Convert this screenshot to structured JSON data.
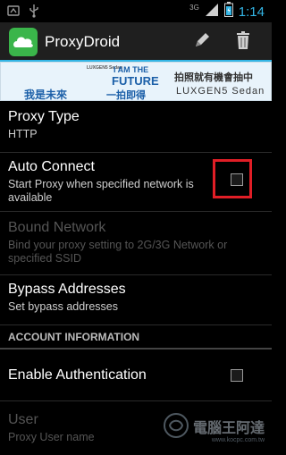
{
  "status_bar": {
    "network": "3G",
    "time": "1:14"
  },
  "action_bar": {
    "title": "ProxyDroid",
    "edit_icon": "pencil-icon",
    "delete_icon": "trash-icon"
  },
  "banner": {
    "brand_small": "LUXGEN5 Sedan",
    "line1": "I AM THE",
    "line2": "FUTURE",
    "zh_left": "我是未來",
    "zh_right": "一拍即得",
    "zh_promo": "拍照就有機會抽中",
    "model": "LUXGEN5 Sedan"
  },
  "prefs": {
    "proxy_type": {
      "title": "Proxy Type",
      "summary": "HTTP"
    },
    "auto_connect": {
      "title": "Auto Connect",
      "summary": "Start Proxy when specified network is available",
      "checked": false
    },
    "bound_network": {
      "title": "Bound Network",
      "summary": "Bind your proxy setting to 2G/3G Network or specified SSID"
    },
    "bypass": {
      "title": "Bypass Addresses",
      "summary": "Set bypass addresses"
    },
    "account_header": "ACCOUNT INFORMATION",
    "enable_auth": {
      "title": "Enable Authentication",
      "checked": false
    },
    "user": {
      "title": "User",
      "summary": "Proxy User name"
    }
  },
  "watermark": {
    "text": "電腦王阿達",
    "url": "www.kocpc.com.tw"
  },
  "colors": {
    "accent": "#33b5e5",
    "highlight": "#e01e26",
    "icon_green": "#3ab54a"
  }
}
